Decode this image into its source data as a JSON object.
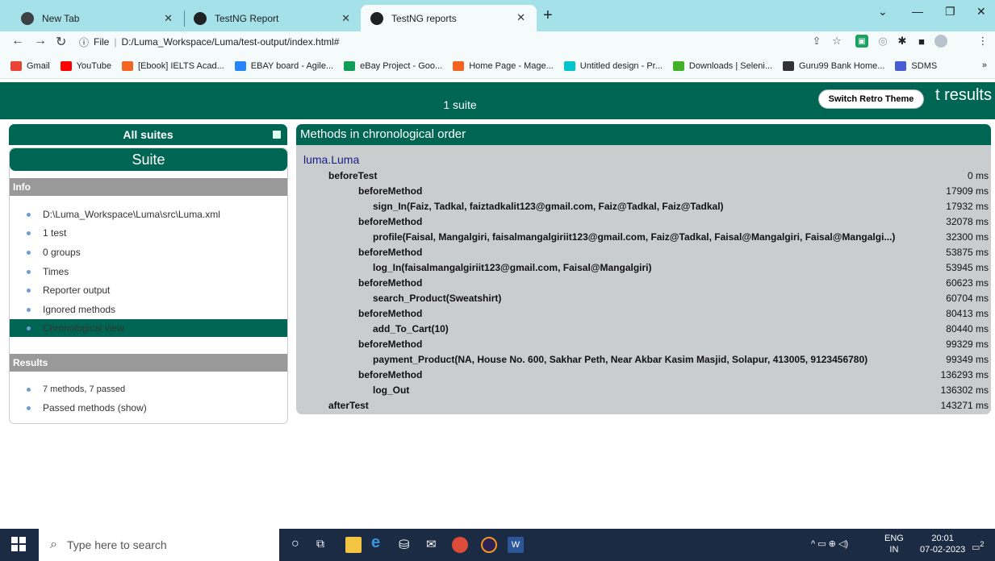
{
  "browser": {
    "tabs": [
      {
        "title": "New Tab"
      },
      {
        "title": "TestNG Report"
      },
      {
        "title": "TestNG reports"
      }
    ],
    "address": {
      "info": "ⓘ",
      "scheme": "File",
      "url": "D:/Luma_Workspace/Luma/test-output/index.html#"
    },
    "bookmarks": [
      {
        "label": "Gmail",
        "color": "#ea4335"
      },
      {
        "label": "YouTube",
        "color": "#ff0000"
      },
      {
        "label": "[Ebook] IELTS Acad...",
        "color": "#f26522"
      },
      {
        "label": "EBAY board - Agile...",
        "color": "#2684ff"
      },
      {
        "label": "eBay Project - Goo...",
        "color": "#0f9d58"
      },
      {
        "label": "Home Page - Mage...",
        "color": "#f26322"
      },
      {
        "label": "Untitled design - Pr...",
        "color": "#00c4cc"
      },
      {
        "label": "Downloads | Seleni...",
        "color": "#43b02a"
      },
      {
        "label": "Guru99 Bank Home...",
        "color": "#333333"
      },
      {
        "label": "SDMS",
        "color": "#4a5bd6"
      }
    ],
    "more": "»"
  },
  "report": {
    "suite_count": "1 suite",
    "header_title": "t results",
    "retro_button": "Switch Retro Theme",
    "all_suites": "All suites",
    "suite_name": "Suite",
    "info_label": "Info",
    "info_items": [
      "D:\\Luma_Workspace\\Luma\\src\\Luma.xml",
      "1 test",
      "0 groups",
      "Times",
      "Reporter output",
      "Ignored methods",
      "Chronological view"
    ],
    "results_label": "Results",
    "results_items": [
      "7 methods, 7 passed",
      "Passed methods (show)"
    ],
    "main_title": "Methods in chronological order",
    "class_name": "luma.Luma",
    "rows": [
      {
        "name": "beforeTest",
        "level": 0,
        "ms": "0 ms"
      },
      {
        "name": "beforeMethod",
        "level": 1,
        "ms": "17909 ms"
      },
      {
        "name": "sign_In(Faiz, Tadkal, faiztadkalit123@gmail.com, Faiz@Tadkal, Faiz@Tadkal)",
        "level": 2,
        "ms": "17932 ms"
      },
      {
        "name": "beforeMethod",
        "level": 1,
        "ms": "32078 ms"
      },
      {
        "name": "profile(Faisal, Mangalgiri, faisalmangalgiriit123@gmail.com, Faiz@Tadkal, Faisal@Mangalgiri, Faisal@Mangalgi...)",
        "level": 2,
        "ms": "32300 ms"
      },
      {
        "name": "beforeMethod",
        "level": 1,
        "ms": "53875 ms"
      },
      {
        "name": "log_In(faisalmangalgiriit123@gmail.com, Faisal@Mangalgiri)",
        "level": 2,
        "ms": "53945 ms"
      },
      {
        "name": "beforeMethod",
        "level": 1,
        "ms": "60623 ms"
      },
      {
        "name": "search_Product(Sweatshirt)",
        "level": 2,
        "ms": "60704 ms"
      },
      {
        "name": "beforeMethod",
        "level": 1,
        "ms": "80413 ms"
      },
      {
        "name": "add_To_Cart(10)",
        "level": 2,
        "ms": "80440 ms"
      },
      {
        "name": "beforeMethod",
        "level": 1,
        "ms": "99329 ms"
      },
      {
        "name": "payment_Product(NA, House No. 600, Sakhar Peth, Near Akbar Kasim Masjid, Solapur, 413005, 9123456780)",
        "level": 2,
        "ms": "99349 ms"
      },
      {
        "name": "beforeMethod",
        "level": 1,
        "ms": "136293 ms"
      },
      {
        "name": "log_Out",
        "level": 2,
        "ms": "136302 ms"
      },
      {
        "name": "afterTest",
        "level": 0,
        "ms": "143271 ms"
      }
    ]
  },
  "taskbar": {
    "search_placeholder": "Type here to search",
    "lang_top": "ENG",
    "lang_bottom": "IN",
    "time": "20:01",
    "date": "07-02-2023",
    "notif_count": "2"
  }
}
